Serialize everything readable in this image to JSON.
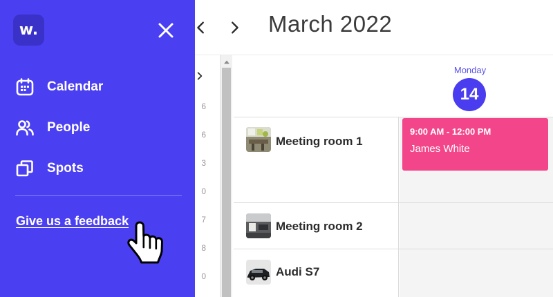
{
  "header": {
    "month_title": "March 2022",
    "prev_icon": "chevron-left-icon",
    "next_icon": "chevron-right-icon"
  },
  "mini_calendar": {
    "visible_digits": [
      "6",
      "6",
      "3",
      "0",
      "7",
      "8",
      "0"
    ]
  },
  "calendar": {
    "day_name": "Monday",
    "day_number": "14",
    "rows": [
      {
        "label": "Meeting room 1",
        "thumb": "meeting-room-photo"
      },
      {
        "label": "Meeting room 2",
        "thumb": "meeting-room-photo"
      },
      {
        "label": "Audi S7",
        "thumb": "car-photo"
      }
    ],
    "event": {
      "time": "9:00 AM - 12:00 PM",
      "person": "James White",
      "color": "#f3468a"
    }
  },
  "drawer": {
    "logo_text": "w.",
    "close_icon": "close-icon",
    "items": [
      {
        "label": "Calendar",
        "icon": "calendar-icon"
      },
      {
        "label": "People",
        "icon": "people-icon"
      },
      {
        "label": "Spots",
        "icon": "spots-icon"
      }
    ],
    "feedback_link": "Give us a feedback",
    "background_color": "#4b3ff2"
  },
  "accent_color": "#4a3df0"
}
